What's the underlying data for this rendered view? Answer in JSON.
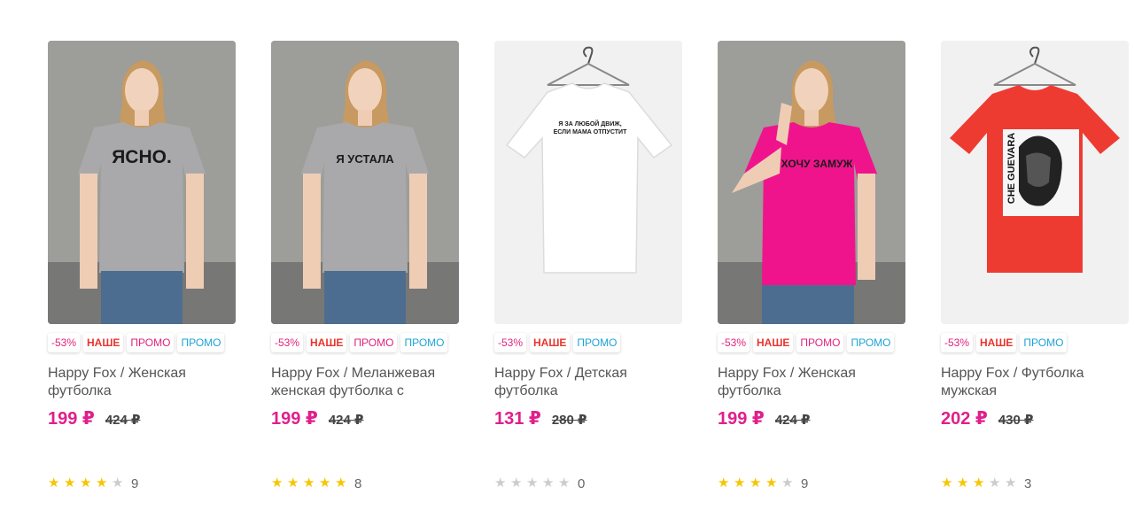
{
  "products": [
    {
      "badges": [
        {
          "text": "-53%",
          "color": "#e0237e",
          "bold": false
        },
        {
          "text": "НАШЕ",
          "color": "#e8352e",
          "bold": true
        },
        {
          "text": "ПРОМО",
          "color": "#e0237e",
          "bold": false
        },
        {
          "text": "ПРОМО",
          "color": "#1da3d8",
          "bold": false
        }
      ],
      "title": "Happy Fox / Женская футболка",
      "price": "199 ₽",
      "old_price": "424 ₽",
      "rating": 4,
      "reviews": "9",
      "shirt_text": "ЯСНО.",
      "shirt_color": "#a9a9ab"
    },
    {
      "badges": [
        {
          "text": "-53%",
          "color": "#e0237e",
          "bold": false
        },
        {
          "text": "НАШЕ",
          "color": "#e8352e",
          "bold": true
        },
        {
          "text": "ПРОМО",
          "color": "#e0237e",
          "bold": false
        },
        {
          "text": "ПРОМО",
          "color": "#1da3d8",
          "bold": false
        }
      ],
      "title": "Happy Fox / Меланжевая женская футболка с",
      "price": "199 ₽",
      "old_price": "424 ₽",
      "rating": 5,
      "reviews": "8",
      "shirt_text": "Я УСТАЛА",
      "shirt_color": "#a9a9ab"
    },
    {
      "badges": [
        {
          "text": "-53%",
          "color": "#e0237e",
          "bold": false
        },
        {
          "text": "НАШЕ",
          "color": "#e8352e",
          "bold": true
        },
        {
          "text": "ПРОМО",
          "color": "#1da3d8",
          "bold": false
        }
      ],
      "title": "Happy Fox / Детская футболка",
      "price": "131 ₽",
      "old_price": "280 ₽",
      "rating": 0,
      "reviews": "0",
      "shirt_text_lines": [
        "Я ЗА ЛЮБОЙ ДВИЖ,",
        "ЕСЛИ МАМА ОТПУСТИТ"
      ],
      "shirt_color": "#ffffff"
    },
    {
      "badges": [
        {
          "text": "-53%",
          "color": "#e0237e",
          "bold": false
        },
        {
          "text": "НАШЕ",
          "color": "#e8352e",
          "bold": true
        },
        {
          "text": "ПРОМО",
          "color": "#e0237e",
          "bold": false
        },
        {
          "text": "ПРОМО",
          "color": "#1da3d8",
          "bold": false
        }
      ],
      "title": "Happy Fox / Женская футболка",
      "price": "199 ₽",
      "old_price": "424 ₽",
      "rating": 4,
      "reviews": "9",
      "shirt_text": "ХОЧУ ЗАМУЖ",
      "shirt_color": "#f0148c"
    },
    {
      "badges": [
        {
          "text": "-53%",
          "color": "#e0237e",
          "bold": false
        },
        {
          "text": "НАШЕ",
          "color": "#e8352e",
          "bold": true
        },
        {
          "text": "ПРОМО",
          "color": "#1da3d8",
          "bold": false
        }
      ],
      "title": "Happy Fox / Футболка мужская",
      "price": "202 ₽",
      "old_price": "430 ₽",
      "rating": 3,
      "reviews": "3",
      "shirt_text": "CHE GUEVARA",
      "shirt_color": "#ee3b32"
    }
  ],
  "colors": {
    "price": "#e01f8c",
    "star_filled": "#f7c600",
    "star_empty": "#cccccc"
  }
}
